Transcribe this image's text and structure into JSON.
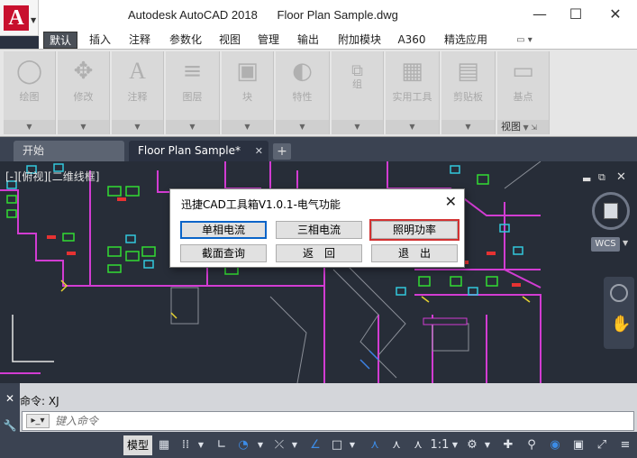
{
  "titlebar": {
    "app_name": "Autodesk AutoCAD 2018",
    "file_name": "Floor Plan Sample.dwg",
    "logo_letter": "A"
  },
  "menu": {
    "tabs": [
      "默认",
      "插入",
      "注释",
      "参数化",
      "视图",
      "管理",
      "输出",
      "附加模块",
      "A360",
      "精选应用"
    ]
  },
  "ribbon": {
    "panels": [
      "绘图",
      "修改",
      "注释",
      "图层",
      "块",
      "特性",
      "组",
      "实用工具",
      "剪贴板",
      "基点"
    ],
    "view_label": "视图"
  },
  "doc_tabs": {
    "start": "开始",
    "active": "Floor Plan Sample*",
    "add": "+"
  },
  "viewport": {
    "label": "[-][俯视][二维线框]",
    "wcs": "WCS"
  },
  "dialog": {
    "title": "迅捷CAD工具箱V1.0.1-电气功能",
    "buttons": [
      "单相电流",
      "三相电流",
      "照明功率",
      "截面查询",
      "返　回",
      "退　出"
    ]
  },
  "command": {
    "history": "命令:  XJ",
    "placeholder": "键入命令"
  },
  "status": {
    "model_tab": "模型",
    "scale": "1:1"
  }
}
